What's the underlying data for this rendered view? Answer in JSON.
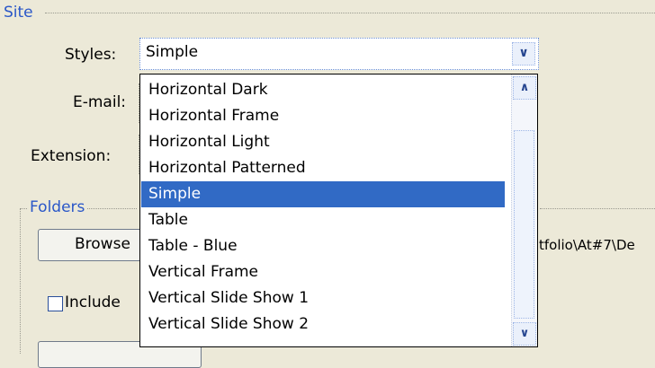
{
  "site_group": {
    "title": "Site"
  },
  "styles": {
    "label": "Styles:",
    "value": "Simple"
  },
  "email": {
    "label": "E-mail:"
  },
  "extension": {
    "label": "Extension:"
  },
  "folders_group": {
    "title": "Folders"
  },
  "browse_button": {
    "label": "Browse"
  },
  "path_text": "tfolio\\At#7\\De",
  "include_checkbox": {
    "label": "Include",
    "checked": false
  },
  "dropdown": {
    "items": [
      "Horizontal Dark",
      "Horizontal Frame",
      "Horizontal Light",
      "Horizontal Patterned",
      "Simple",
      "Table",
      "Table - Blue",
      "Vertical Frame",
      "Vertical Slide Show 1",
      "Vertical Slide Show 2"
    ],
    "selected": "Simple"
  },
  "icons": {
    "combo_arrow": "chevron-down-icon",
    "scroll_up": "chevron-up-icon",
    "scroll_down": "chevron-down-icon"
  },
  "colors": {
    "background": "#ece9d8",
    "group_title": "#2a57c8",
    "selection": "#316ac5"
  }
}
